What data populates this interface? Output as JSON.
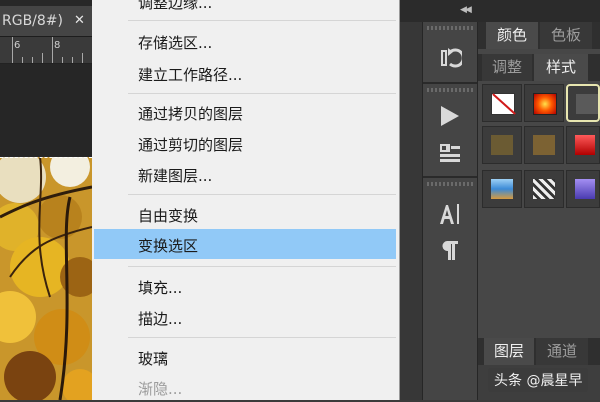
{
  "document": {
    "tab_title": "RGB/8#)",
    "ruler_labels": [
      "6",
      "8"
    ]
  },
  "context_menu": {
    "items": [
      {
        "label": "调整边缘...",
        "state": "partial"
      },
      {
        "label": "存储选区..."
      },
      {
        "label": "建立工作路径..."
      },
      {
        "label": "通过拷贝的图层"
      },
      {
        "label": "通过剪切的图层"
      },
      {
        "label": "新建图层..."
      },
      {
        "label": "自由变换"
      },
      {
        "label": "变换选区",
        "highlighted": true
      },
      {
        "label": "填充..."
      },
      {
        "label": "描边..."
      },
      {
        "label": "玻璃"
      },
      {
        "label": "渐隐...",
        "disabled": true
      }
    ],
    "highlight_color": "#91c9f7"
  },
  "panels": {
    "collapse_icon": "double-chevron-left-icon",
    "top_tabs": [
      "颜色",
      "色板"
    ],
    "style_tabs": [
      "调整",
      "样式"
    ],
    "active_style_tab": "样式",
    "bottom_tabs": [
      "图层",
      "通道"
    ],
    "dock_tools": [
      "history-brush-icon",
      "play-icon",
      "layer-comps-icon",
      "character-icon",
      "paragraph-icon"
    ]
  },
  "watermark": "头条 @晨星早"
}
